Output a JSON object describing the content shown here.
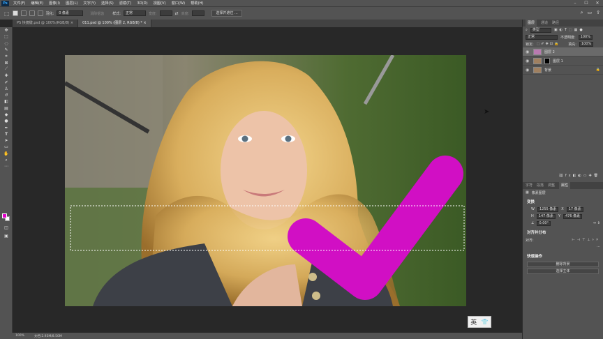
{
  "menubar": {
    "items": [
      "文件(F)",
      "编辑(E)",
      "图像(I)",
      "图层(L)",
      "文字(Y)",
      "选择(S)",
      "滤镜(T)",
      "3D(D)",
      "视图(V)",
      "窗口(W)",
      "帮助(H)"
    ]
  },
  "options": {
    "feather_label": "羽化:",
    "feather_value": "0 像素",
    "antialias": "消除锯齿",
    "style_label": "样式:",
    "style_value": "正常",
    "width_label": "宽度:",
    "height_label": "高度:",
    "select_mask_button": "选择并遮住 ..."
  },
  "tabs": [
    {
      "label": "PS 快捷键.psd @ 100%(RGB/8)",
      "active": false
    },
    {
      "label": "011.psd @ 100% (图层 2, RGB/8) *",
      "active": true
    }
  ],
  "panels": {
    "layers_tabs": [
      "图层",
      "通道",
      "路径"
    ],
    "kind_label": "类型",
    "blend_mode": "正常",
    "opacity_label": "不透明度:",
    "opacity_value": "100%",
    "lock_label": "锁定:",
    "fill_label": "填充:",
    "fill_value": "100%",
    "layers": [
      {
        "name": "图层 2",
        "selected": true
      },
      {
        "name": "图层 1",
        "selected": false
      },
      {
        "name": "背景",
        "selected": false
      }
    ],
    "props_tabs": [
      "字符",
      "段落",
      "调整",
      "属性"
    ],
    "props_title": "像素图层",
    "transform_title": "变换",
    "w_label": "W",
    "w_value": "1255 像素",
    "h_label": "H",
    "h_value": "147 像素",
    "x_label": "X",
    "x_value": "17 像素",
    "y_label": "Y",
    "y_value": "476 像素",
    "angle_value": "0.00°",
    "align_title": "对齐并分布",
    "align_label": "对齐:",
    "quick_title": "快速操作",
    "btn_remove_bg": "删除背景",
    "btn_select_subject": "选择主体"
  },
  "status": {
    "zoom": "100%",
    "doc": "文档:2.93M/8.50M"
  },
  "ime": {
    "label": "英"
  }
}
